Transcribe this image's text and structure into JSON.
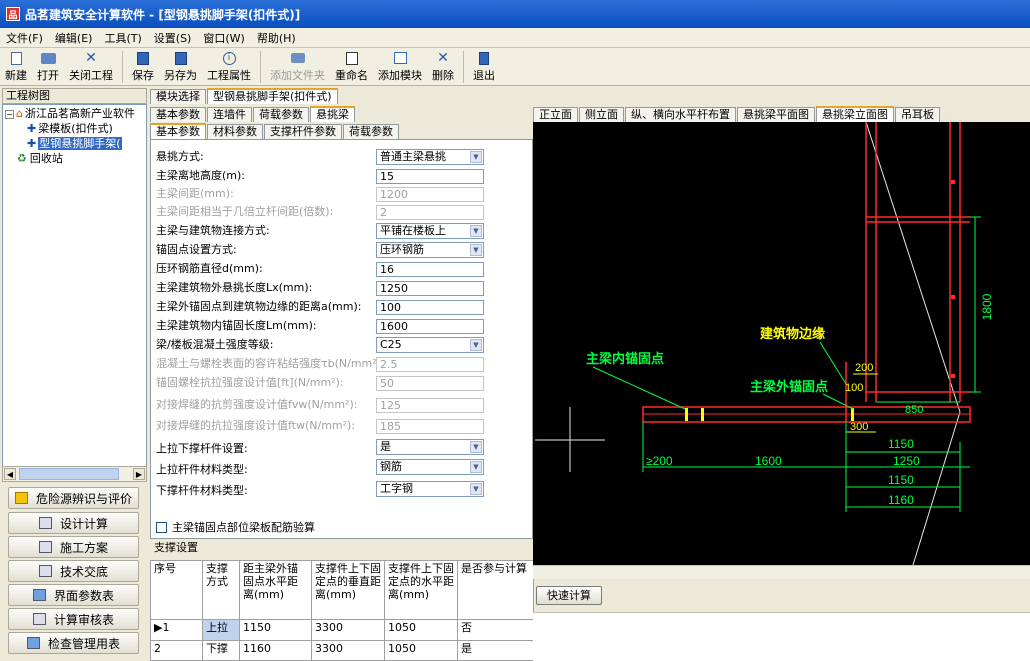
{
  "window": {
    "title": "品茗建筑安全计算软件 - [型钢悬挑脚手架(扣件式)]"
  },
  "menu": [
    "文件(F)",
    "编辑(E)",
    "工具(T)",
    "设置(S)",
    "窗口(W)",
    "帮助(H)"
  ],
  "toolbar": {
    "new": "新建",
    "open": "打开",
    "close_project": "关闭工程",
    "save": "保存",
    "save_as": "另存为",
    "project_props": "工程属性",
    "add_file": "添加文件夹",
    "rename": "重命名",
    "add_module": "添加模块",
    "delete": "删除",
    "exit": "退出"
  },
  "tree": {
    "header": "工程树图",
    "items": [
      "浙江品茗高新产业软件",
      "梁模板(扣件式)",
      "型钢悬挑脚手架(",
      "回收站"
    ]
  },
  "nav": [
    "危险源辨识与评价",
    "设计计算",
    "施工方案",
    "技术交底",
    "界面参数表",
    "计算审核表",
    "检查管理用表"
  ],
  "module_tabs": [
    "模块选择",
    "型钢悬挑脚手架(扣件式)"
  ],
  "param_tabs": [
    "基本参数",
    "连墙件",
    "荷载参数",
    "悬挑梁"
  ],
  "sub_tabs": [
    "基本参数",
    "材料参数",
    "支撑杆件参数",
    "荷载参数"
  ],
  "form": [
    {
      "label": "悬挑方式:",
      "value": "普通主梁悬挑",
      "kind": "select",
      "disabled": false
    },
    {
      "label": "主梁离地高度(m):",
      "value": "15",
      "kind": "input",
      "disabled": false
    },
    {
      "label": "主梁间距(mm):",
      "value": "1200",
      "kind": "input",
      "disabled": true
    },
    {
      "label": "主梁间距相当于几倍立杆间距(倍数):",
      "value": "2",
      "kind": "input",
      "disabled": true
    },
    {
      "label": "主梁与建筑物连接方式:",
      "value": "平铺在楼板上",
      "kind": "select",
      "disabled": false
    },
    {
      "label": "锚固点设置方式:",
      "value": "压环钢筋",
      "kind": "select",
      "disabled": false
    },
    {
      "label": "压环钢筋直径d(mm):",
      "value": "16",
      "kind": "input",
      "disabled": false
    },
    {
      "label": "主梁建筑物外悬挑长度Lx(mm):",
      "value": "1250",
      "kind": "input",
      "disabled": false
    },
    {
      "label": "主梁外锚固点到建筑物边缘的距离a(mm):",
      "value": "100",
      "kind": "input",
      "disabled": false
    },
    {
      "label": "主梁建筑物内锚固长度Lm(mm):",
      "value": "1600",
      "kind": "input",
      "disabled": false
    },
    {
      "label": "梁/楼板混凝土强度等级:",
      "value": "C25",
      "kind": "select",
      "disabled": false
    },
    {
      "label": "混凝土与螺栓表面的容许粘结强度τb(N/mm²)",
      "value": "2.5",
      "kind": "input",
      "disabled": true
    },
    {
      "label": "锚固螺栓抗拉强度设计值[ft](N/mm²):",
      "value": "50",
      "kind": "input",
      "disabled": true
    },
    {
      "label": "对接焊缝的抗剪强度设计值fvw(N/mm²):",
      "value": "125",
      "kind": "input",
      "disabled": true
    },
    {
      "label": "对接焊缝的抗拉强度设计值ftw(N/mm²):",
      "value": "185",
      "kind": "input",
      "disabled": true
    },
    {
      "label": "上拉下撑杆件设置:",
      "value": "是",
      "kind": "select",
      "disabled": false
    },
    {
      "label": "上拉杆件材料类型:",
      "value": "钢筋",
      "kind": "select",
      "disabled": false
    },
    {
      "label": "下撑杆件材料类型:",
      "value": "工字钢",
      "kind": "select",
      "disabled": false
    }
  ],
  "checkbox_label": "主梁锚固点部位梁板配筋验算",
  "support_header": "支撑设置",
  "support_table": {
    "columns": [
      "序号",
      "支撑方式",
      "距主梁外锚固点水平距离(mm)",
      "支撑件上下固定点的垂直距离(mm)",
      "支撑件上下固定点的水平距离(mm)",
      "是否参与计算"
    ],
    "rows": [
      [
        "1",
        "上拉",
        "1150",
        "3300",
        "1050",
        "否"
      ],
      [
        "2",
        "下撑",
        "1160",
        "3300",
        "1050",
        "是"
      ]
    ]
  },
  "view_tabs": [
    "正立面",
    "侧立面",
    "纵、横向水平杆布置",
    "悬挑梁平面图",
    "悬挑梁立面图",
    "吊耳板"
  ],
  "drawing": {
    "labels": {
      "inner_anchor": "主梁内锚固点",
      "building_edge": "建筑物边缘",
      "outer_anchor": "主梁外锚固点"
    },
    "dims": [
      "1800",
      "200",
      "100",
      "850",
      "300",
      "1150",
      "≥200",
      "1600",
      "1250",
      "1150",
      "1160"
    ]
  },
  "quick_calc": "快速计算",
  "colors": {
    "title_bg": "#0a4ec0",
    "canvas_bg": "#000000",
    "red_line": "#ff2a2a",
    "green_text": "#00ff40",
    "yellow_text": "#ffff00"
  }
}
